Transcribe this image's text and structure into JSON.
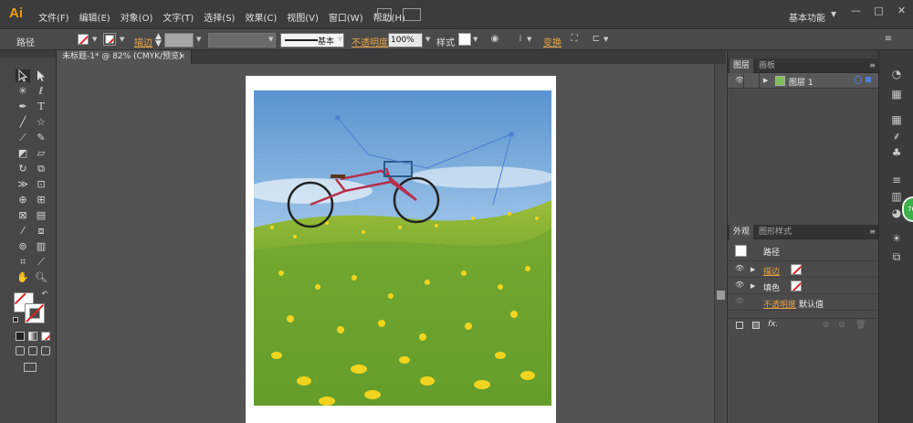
{
  "app": {
    "logo": "Ai"
  },
  "menubar": {
    "items": [
      "文件(F)",
      "编辑(E)",
      "对象(O)",
      "文字(T)",
      "选择(S)",
      "效果(C)",
      "视图(V)",
      "窗口(W)",
      "帮助(H)"
    ],
    "workspace": "基本功能",
    "window_buttons": [
      "—",
      "□",
      "✕"
    ]
  },
  "controlbar": {
    "selection_label": "路径",
    "stroke_label": "描边",
    "stroke_style": "基本",
    "opacity_label": "不透明度",
    "opacity_value": "100%",
    "style_label": "样式",
    "transform_label": "变换"
  },
  "document": {
    "tab_title": "未标题-1* @ 82% (CMYK/预览)",
    "tab_close": "×"
  },
  "layers_panel": {
    "tabs": [
      "图层",
      "画板"
    ],
    "layer_name": "图层 1"
  },
  "appearance_panel": {
    "tabs": [
      "外观",
      "图形样式"
    ],
    "object_label": "路径",
    "stroke_label": "描边",
    "fill_label": "填色",
    "opacity_label": "不透明度",
    "opacity_value": "默认值",
    "fx_label": "fx."
  },
  "badge": {
    "text": "76"
  },
  "colors": {
    "accent": "#e8a34a",
    "logo": "#f39c12",
    "badge": "#3bb04a"
  }
}
